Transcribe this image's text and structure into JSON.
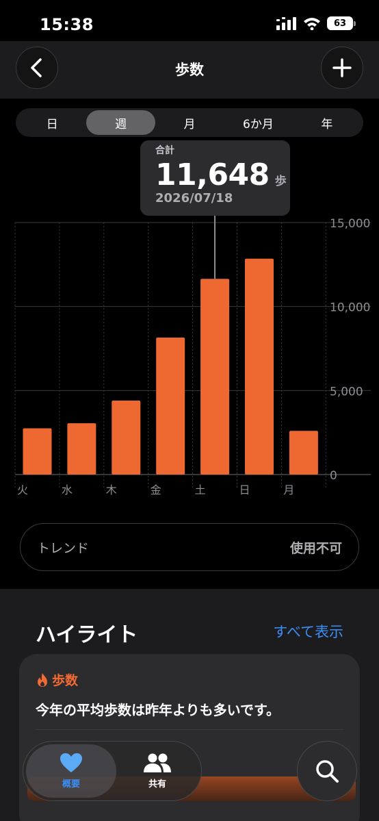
{
  "status_bar": {
    "time": "15:38",
    "battery": "63"
  },
  "header": {
    "title": "歩数"
  },
  "period_tabs": [
    {
      "label": "日",
      "active": false
    },
    {
      "label": "週",
      "active": true
    },
    {
      "label": "月",
      "active": false
    },
    {
      "label": "6か月",
      "active": false
    },
    {
      "label": "年",
      "active": false
    }
  ],
  "tooltip": {
    "label": "合計",
    "value": "11,648",
    "unit": "歩",
    "date": "2026/07/18"
  },
  "chart_data": {
    "type": "bar",
    "categories": [
      "火",
      "水",
      "木",
      "金",
      "土",
      "日",
      "月"
    ],
    "values": [
      2750,
      3050,
      4400,
      8150,
      11648,
      12850,
      2600
    ],
    "y_ticks": [
      "15,000",
      "10,000",
      "5,000",
      "0"
    ],
    "ylim": [
      0,
      15000
    ],
    "bar_color": "#ee6832",
    "highlighted_index": 4,
    "grid": true
  },
  "trend": {
    "label": "トレンド",
    "status": "使用不可"
  },
  "highlights": {
    "title": "ハイライト",
    "see_all": "すべて表示",
    "card": {
      "tag": "歩数",
      "text": "今年の平均歩数は昨年よりも多いです。",
      "accent": "#f26b33"
    }
  },
  "tab_bar": {
    "items": [
      {
        "label": "概要",
        "icon": "heart-icon",
        "active": true
      },
      {
        "label": "共有",
        "icon": "people-icon",
        "active": false
      }
    ],
    "accent": "#3c8ef7"
  }
}
